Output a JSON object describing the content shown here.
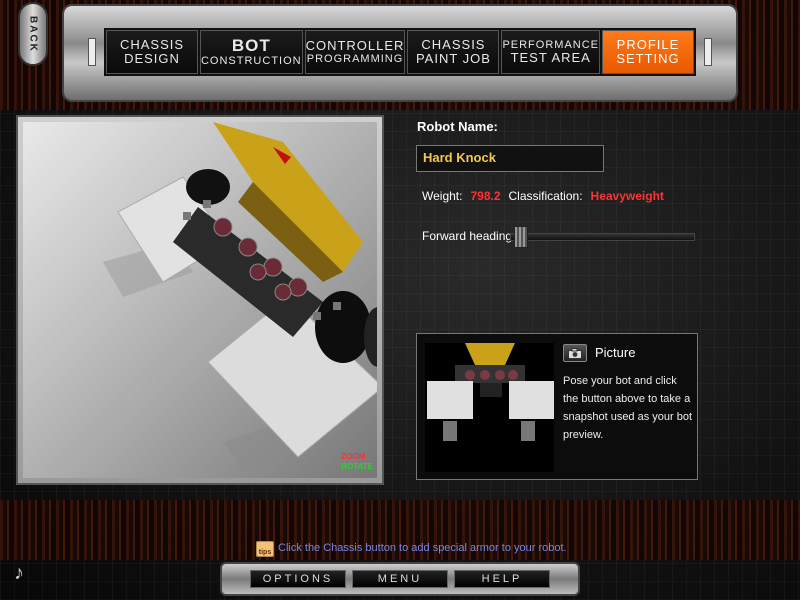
{
  "nav": {
    "back_label": "BACK",
    "tabs": [
      {
        "line1": "CHASSIS",
        "line2": "DESIGN",
        "style": "normal"
      },
      {
        "line1": "BOT",
        "line2": "CONSTRUCTION",
        "style": "big"
      },
      {
        "line1": "CONTROLLER",
        "line2": "PROGRAMMING",
        "style": "mixed"
      },
      {
        "line1": "CHASSIS",
        "line2": "PAINT JOB",
        "style": "normal"
      },
      {
        "line1": "PERFORMANCE",
        "line2": "TEST AREA",
        "style": "mixed"
      },
      {
        "line1": "PROFILE",
        "line2": "SETTING",
        "style": "active"
      }
    ]
  },
  "viewer": {
    "zoom_label": "ZOOM",
    "rotate_label": "ROTATE"
  },
  "profile": {
    "robot_name_label": "Robot Name:",
    "robot_name_value": "Hard Knock",
    "weight_label": "Weight:",
    "weight_value": "798.2",
    "classification_label": "Classification:",
    "classification_value": "Heavyweight",
    "heading_label": "Forward heading:",
    "heading_fraction": 0.02
  },
  "picture": {
    "title": "Picture",
    "description": "Pose your bot and click the button above to take a snapshot used as your bot preview."
  },
  "tips": {
    "icon_label": "tips",
    "text": "Click the Chassis button to add special armor to your robot."
  },
  "bottom_menu": {
    "options_label": "OPTIONS",
    "menu_label": "MENU",
    "help_label": "HELP"
  },
  "colors": {
    "accent_orange": "#ff7a1a",
    "name_gold": "#f3c94a",
    "stat_red": "#ff3333",
    "tips_blue": "#7a84e6"
  },
  "icons": {
    "camera": "camera-icon",
    "music": "music-note-icon",
    "tips": "tips-icon"
  }
}
